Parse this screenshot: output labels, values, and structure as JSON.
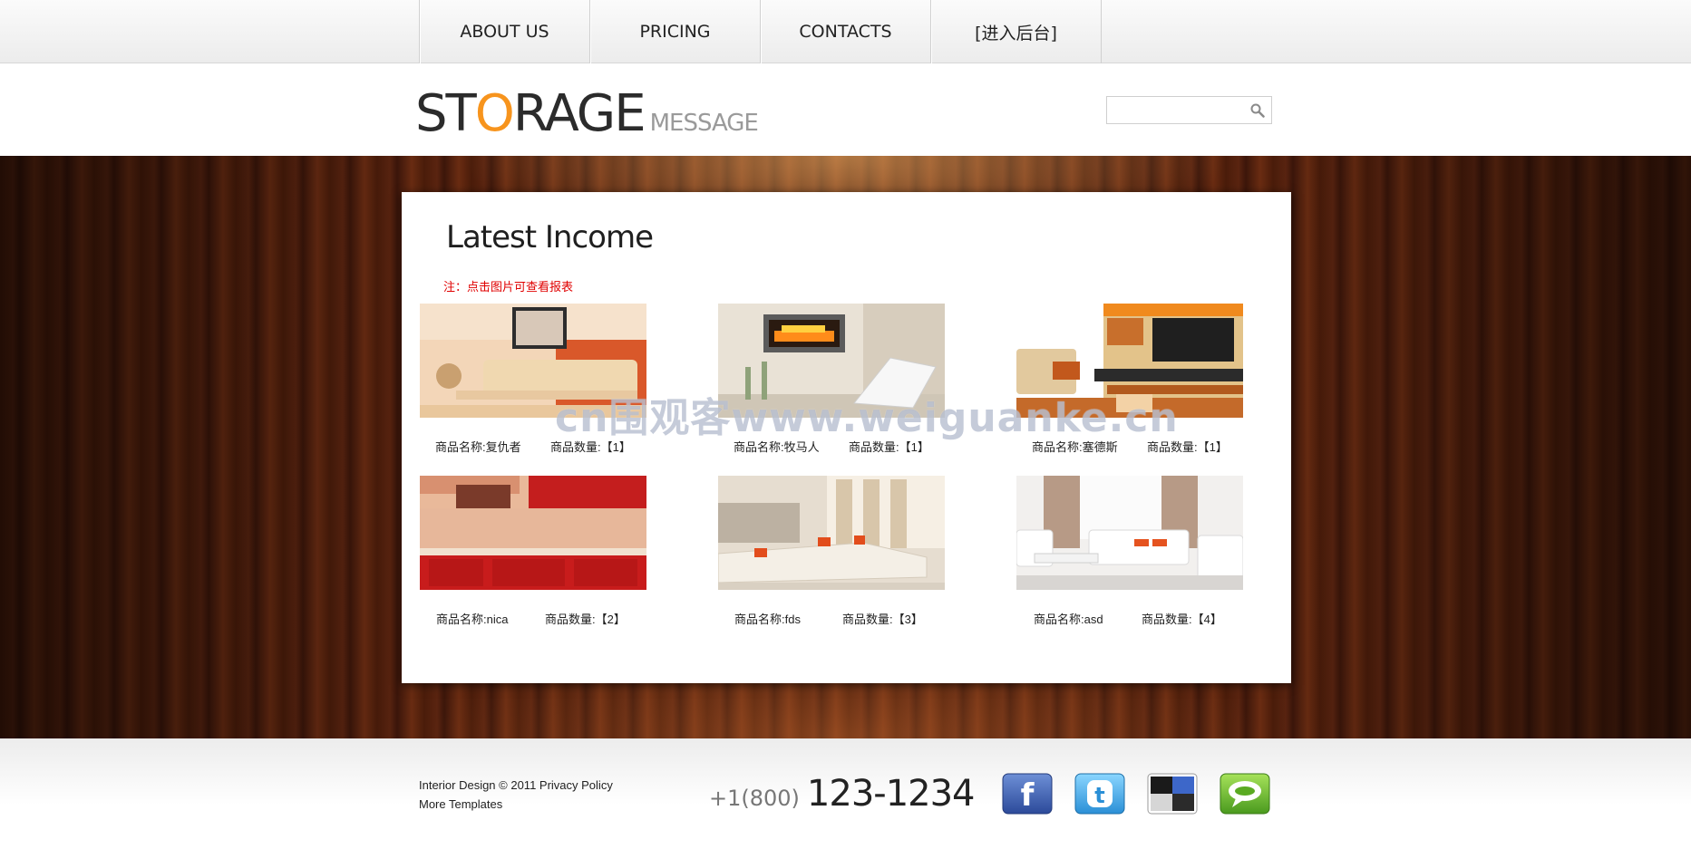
{
  "nav": {
    "items": [
      {
        "label": "ABOUT US"
      },
      {
        "label": "PRICING"
      },
      {
        "label": "CONTACTS"
      },
      {
        "label": "[进入后台]"
      }
    ]
  },
  "header": {
    "logo_s": "ST",
    "logo_o": "O",
    "logo_rest": "RAGE",
    "logo_sub": "MESSAGE",
    "search_value": ""
  },
  "main": {
    "title": "Latest Income",
    "note": "注：点击图片可查看报表",
    "products": [
      {
        "name": "商品名称:复仇者",
        "qty": "商品数量:【1】"
      },
      {
        "name": "商品名称:牧马人",
        "qty": "商品数量:【1】"
      },
      {
        "name": "商品名称:塞德斯",
        "qty": "商品数量:【1】"
      },
      {
        "name": "商品名称:nica",
        "qty": "商品数量:【2】"
      },
      {
        "name": "商品名称:fds",
        "qty": "商品数量:【3】"
      },
      {
        "name": "商品名称:asd",
        "qty": "商品数量:【4】"
      }
    ],
    "watermark": "cn围观客www.weiguanke.cn"
  },
  "footer": {
    "copyright": "Interior Design © 2011 Privacy Policy",
    "more": "More Templates",
    "phone_prefix": "+1(800)",
    "phone_number": "123-1234",
    "social": [
      "facebook-icon",
      "twitter-icon",
      "delicious-icon",
      "chat-icon"
    ]
  },
  "colors": {
    "accent": "#f7941d",
    "note_red": "#e00000",
    "wood": "#4a1c0a"
  }
}
